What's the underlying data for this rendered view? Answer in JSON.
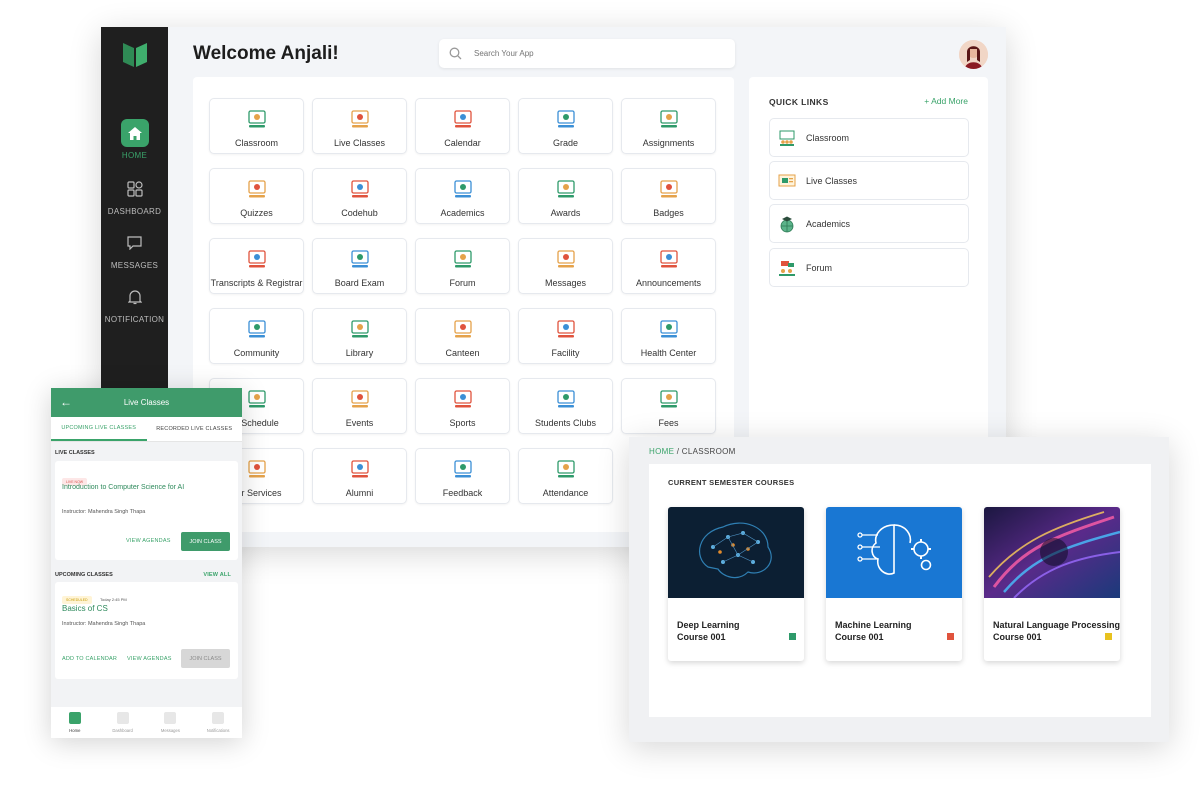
{
  "dashboard": {
    "welcome": "Welcome Anjali!",
    "search_placeholder": "Search Your App",
    "nav": [
      {
        "label": "HOME",
        "icon": "home-icon"
      },
      {
        "label": "DASHBOARD",
        "icon": "dashboard-icon"
      },
      {
        "label": "MESSAGES",
        "icon": "message-icon"
      },
      {
        "label": "NOTIFICATION",
        "icon": "bell-icon"
      }
    ],
    "apps": [
      "Classroom",
      "Live Classes",
      "Calendar",
      "Grade",
      "Assignments",
      "Quizzes",
      "Codehub",
      "Academics",
      "Awards",
      "Badges",
      "Transcripts & Registrar",
      "Board Exam",
      "Forum",
      "Messages",
      "Announcements",
      "Community",
      "Library",
      "Canteen",
      "Facility",
      "Health Center",
      "s Schedule",
      "Events",
      "Sports",
      "Students Clubs",
      "Fees",
      "eer Services",
      "Alumni",
      "Feedback",
      "Attendance"
    ],
    "quick_links": {
      "title": "QUICK LINKS",
      "add_more": "+ Add More",
      "items": [
        "Classroom",
        "Live Classes",
        "Academics",
        "Forum"
      ]
    }
  },
  "mobile": {
    "header": "Live Classes",
    "tabs": [
      "UPCOMING LIVE CLASSES",
      "RECORDED LIVE CLASSES"
    ],
    "live_section": "LIVE CLASSES",
    "live_card": {
      "badge": "LIVE NOW",
      "title": "Introduction to Computer Science for AI",
      "instructor": "Instructor: Mahendra Singh Thapa",
      "view_agendas": "VIEW AGENDAS",
      "join": "JOIN CLASS"
    },
    "upcoming_section": "UPCOMING CLASSES",
    "view_all": "VIEW ALL",
    "upcoming_card": {
      "badge": "SCHEDULED",
      "time": "Today 2:45 PM",
      "title": "Basics of CS",
      "instructor": "Instructor: Mahendra Singh Thapa",
      "add_calendar": "ADD TO CALENDAR",
      "view_agendas": "VIEW AGENDAS",
      "join": "JOIN CLASS"
    },
    "footer": [
      "Home",
      "Dashboard",
      "Messages",
      "Notifications"
    ]
  },
  "classroom": {
    "breadcrumb_home": "HOME",
    "breadcrumb_sep": "/",
    "breadcrumb_current": "CLASSROOM",
    "section_title": "CURRENT SEMESTER COURSES",
    "courses": [
      {
        "line1": "Deep Learning",
        "line2": "Course 001",
        "color": "#2e9a6a"
      },
      {
        "line1": "Machine Learning",
        "line2": "Course 001",
        "color": "#e0533d"
      },
      {
        "line1": "Natural Language Processing",
        "line2": "Course 001",
        "color": "#e8c21f"
      }
    ]
  },
  "theme": {
    "accent": "#3aa36a",
    "sidebar": "#1f1f1f"
  }
}
